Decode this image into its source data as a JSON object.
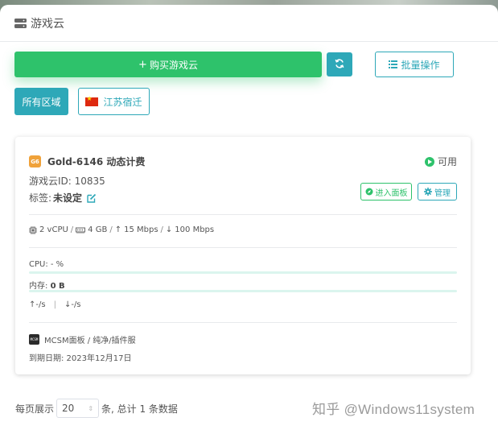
{
  "header": {
    "title": "游戏云"
  },
  "toolbar": {
    "buy_label": "购买游戏云",
    "batch_label": "批量操作"
  },
  "regions": {
    "all_label": "所有区域",
    "region_label": "江苏宿迁"
  },
  "card": {
    "badge": "G6",
    "plan_name": "Gold-6146 动态计费",
    "status": "可用",
    "id_line": "游戏云ID: 10835",
    "tag_label": "标签:",
    "tag_value": "未设定",
    "enter_panel_label": "进入面板",
    "manage_label": "管理",
    "specs": {
      "cpu": "2 vCPU",
      "ram": "4 GB",
      "up": "15 Mbps",
      "down": "100 Mbps"
    },
    "cpu_line": "CPU:  - %",
    "cpu_usage": 0,
    "mem_label": "内存:",
    "mem_value": "0 B",
    "mem_usage": 0,
    "net_up": "↑-/s",
    "net_sep": "|",
    "net_down": "↓-/s",
    "mcsm_logo_text": "MCSM",
    "mcsm_line": "MCSM面板 / 纯净/插件服",
    "expire_line": "到期日期:  2023年12月17日"
  },
  "pagination": {
    "prefix": "每页展示",
    "page_size": "20",
    "suffix": "条, 总计 1 条数据"
  },
  "watermark": "知乎 @Windows11system",
  "colors": {
    "green": "#2ec26b",
    "teal": "#2ea8b8",
    "badge_orange": "#f0a23a"
  }
}
